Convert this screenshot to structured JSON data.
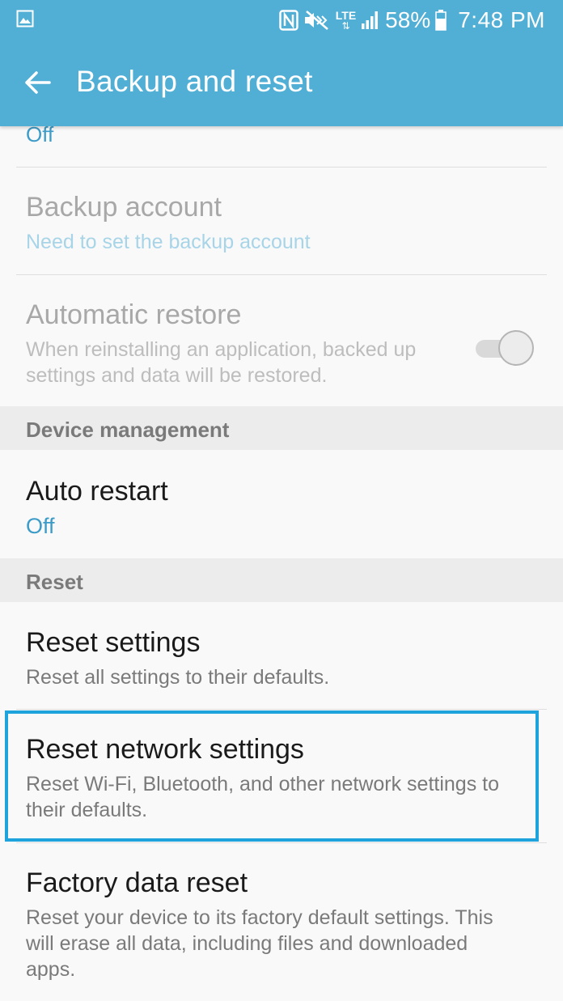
{
  "status_bar": {
    "battery_percent": "58%",
    "time": "7:48 PM",
    "network_label": "LTE",
    "icons": [
      "gallery-icon",
      "nfc-icon",
      "mute-icon",
      "lte-icon",
      "signal-icon",
      "battery-icon"
    ]
  },
  "app_bar": {
    "title": "Backup and reset",
    "back_icon": "arrow-left-icon",
    "color": "#51afd6"
  },
  "settings": {
    "backup_my_data_value": "Off",
    "backup_account": {
      "title": "Backup account",
      "subtitle": "Need to set the backup account"
    },
    "automatic_restore": {
      "title": "Automatic restore",
      "subtitle": "When reinstalling an application, backed up settings and data will be restored.",
      "toggle_on": true
    },
    "device_management_header": "Device management",
    "auto_restart": {
      "title": "Auto restart",
      "value": "Off"
    },
    "reset_header": "Reset",
    "reset_settings": {
      "title": "Reset settings",
      "subtitle": "Reset all settings to their defaults."
    },
    "reset_network_settings": {
      "title": "Reset network settings",
      "subtitle": "Reset Wi-Fi, Bluetooth, and other network settings to their defaults."
    },
    "factory_data_reset": {
      "title": "Factory data reset",
      "subtitle": "Reset your device to its factory default settings. This will erase all data, including files and downloaded apps."
    }
  },
  "colors": {
    "accent": "#51afd6",
    "link_blue": "#3c9bc7",
    "highlight_border": "#1ea3dd"
  }
}
